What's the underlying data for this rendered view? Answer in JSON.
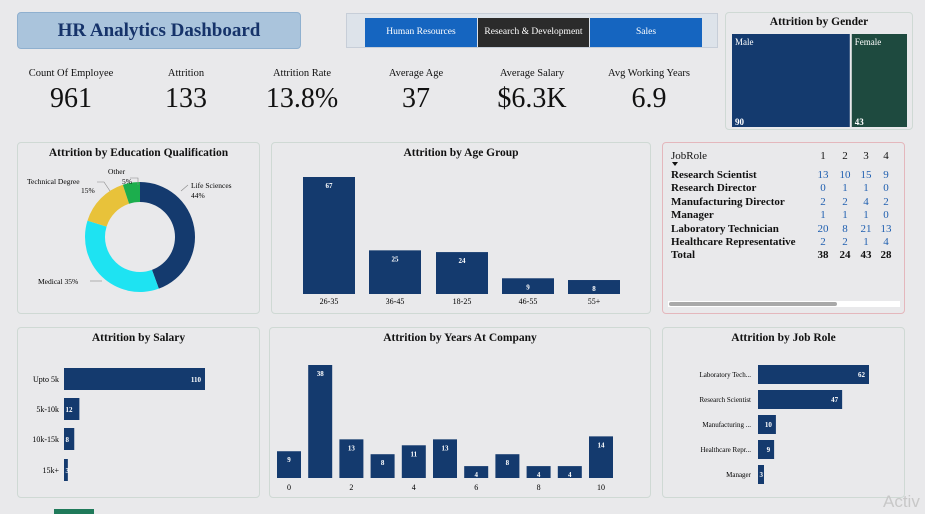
{
  "header": {
    "title": "HR Analytics Dashboard"
  },
  "nav": {
    "items": [
      {
        "label": "Human Resources",
        "color": "#1565c0"
      },
      {
        "label": "Research & Development",
        "color": "#2b2b2b"
      },
      {
        "label": "Sales",
        "color": "#1565c0"
      }
    ]
  },
  "kpis": [
    {
      "label": "Count Of Employee",
      "value": "961"
    },
    {
      "label": "Attrition",
      "value": "133"
    },
    {
      "label": "Attrition Rate",
      "value": "13.8%"
    },
    {
      "label": "Average Age",
      "value": "37"
    },
    {
      "label": "Average Salary",
      "value": "$6.3K"
    },
    {
      "label": "Avg Working Years",
      "value": "6.9"
    }
  ],
  "jobrole_table": {
    "header": "JobRole",
    "columns": [
      "1",
      "2",
      "3",
      "4"
    ],
    "rows": [
      {
        "name": "Research Scientist",
        "values": [
          "13",
          "10",
          "15",
          "9"
        ]
      },
      {
        "name": "Research Director",
        "values": [
          "0",
          "1",
          "1",
          "0"
        ]
      },
      {
        "name": "Manufacturing Director",
        "values": [
          "2",
          "2",
          "4",
          "2"
        ]
      },
      {
        "name": "Manager",
        "values": [
          "1",
          "1",
          "1",
          "0"
        ]
      },
      {
        "name": "Laboratory Technician",
        "values": [
          "20",
          "8",
          "21",
          "13"
        ]
      },
      {
        "name": "Healthcare Representative",
        "values": [
          "2",
          "2",
          "1",
          "4"
        ]
      }
    ],
    "total": {
      "name": "Total",
      "values": [
        "38",
        "24",
        "43",
        "28"
      ]
    }
  },
  "watermark": "Activ",
  "chart_data": [
    {
      "type": "treemap",
      "title": "Attrition by Gender",
      "categories": [
        "Male",
        "Female"
      ],
      "values": [
        90,
        43
      ],
      "colors": [
        "#143a6e",
        "#1e4a3f"
      ]
    },
    {
      "type": "pie",
      "title": "Attrition by Education Qualification",
      "categories": [
        "Life Sciences",
        "Medical",
        "Technical Degree",
        "Other"
      ],
      "values": [
        44,
        35,
        15,
        5
      ],
      "labels": [
        "Life Sciences 44%",
        "Medical 35%",
        "Technical Degree 15%",
        "Other 5%"
      ],
      "colors": [
        "#143a6e",
        "#1ee3f2",
        "#e8c23a",
        "#1cae4d"
      ]
    },
    {
      "type": "bar",
      "title": "Attrition by Age Group",
      "categories": [
        "26-35",
        "36-45",
        "18-25",
        "46-55",
        "55+"
      ],
      "values": [
        67,
        25,
        24,
        9,
        8
      ],
      "color": "#143a6e"
    },
    {
      "type": "bar",
      "orientation": "horizontal",
      "title": "Attrition by Salary",
      "categories": [
        "Upto 5k",
        "5k-10k",
        "10k-15k",
        "15k+"
      ],
      "values": [
        110,
        12,
        8,
        3
      ],
      "color": "#143a6e"
    },
    {
      "type": "bar",
      "title": "Attrition by Years At Company",
      "x": [
        0,
        1,
        2,
        3,
        4,
        5,
        6,
        7,
        8,
        9,
        10
      ],
      "values": [
        9,
        38,
        13,
        8,
        11,
        13,
        4,
        8,
        4,
        4,
        14
      ],
      "tick_labels": [
        "0",
        "2",
        "4",
        "6",
        "8",
        "10"
      ],
      "color": "#143a6e"
    },
    {
      "type": "bar",
      "orientation": "horizontal",
      "title": "Attrition by Job Role",
      "categories": [
        "Laboratory Tech...",
        "Research Scientist",
        "Manufacturing ...",
        "Healthcare Repr...",
        "Manager"
      ],
      "values": [
        62,
        47,
        10,
        9,
        3
      ],
      "color": "#143a6e"
    }
  ]
}
